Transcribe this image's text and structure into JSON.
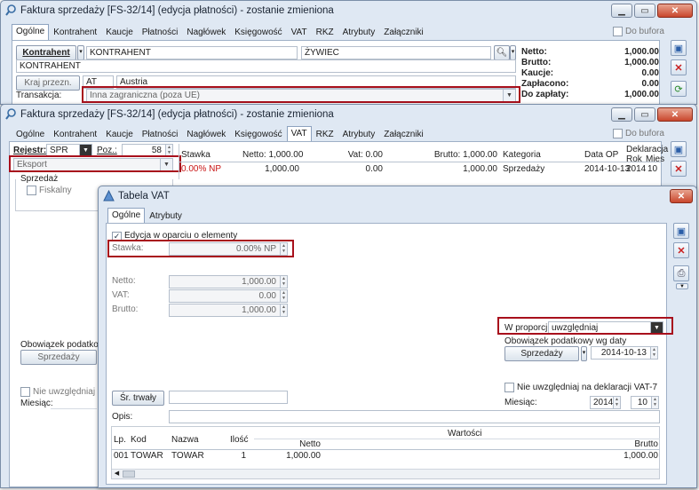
{
  "w1": {
    "title": "Faktura sprzedaży [FS-32/14] (edycja płatności) - zostanie zmieniona",
    "tabs": [
      "Ogólne",
      "Kontrahent",
      "Kaucje",
      "Płatności",
      "Nagłówek",
      "Księgowość",
      "VAT",
      "RKZ",
      "Atrybuty",
      "Załączniki"
    ],
    "do_bufora": "Do bufora",
    "kontrahent_btn": "Kontrahent",
    "kontrahent_code": "KONTRAHENT",
    "city": "ŻYWIEC",
    "kontrahent_name": "KONTRAHENT",
    "kraj_btn": "Kraj przezn.",
    "kraj_code": "AT",
    "kraj_name": "Austria",
    "transakcja_label": "Transakcja:",
    "transakcja_value": "Inna zagraniczna (poza UE)",
    "summary": [
      {
        "label": "Netto:",
        "value": "1,000.00"
      },
      {
        "label": "Brutto:",
        "value": "1,000.00"
      },
      {
        "label": "Kaucje:",
        "value": "0.00"
      },
      {
        "label": "Zapłacono:",
        "value": "0.00"
      },
      {
        "label": "Do zapłaty:",
        "value": "1,000.00"
      }
    ]
  },
  "w2": {
    "title": "Faktura sprzedaży [FS-32/14] (edycja płatności) - zostanie zmieniona",
    "tabs": [
      "Ogólne",
      "Kontrahent",
      "Kaucje",
      "Płatności",
      "Nagłówek",
      "Księgowość",
      "VAT",
      "RKZ",
      "Atrybuty",
      "Załączniki"
    ],
    "do_bufora": "Do bufora",
    "rejestr_label": "Rejestr:",
    "rejestr_value": "SPR",
    "poz_label": "Poz.:",
    "poz_value": "58",
    "eksport": "Eksport",
    "sprzedaz_group": "Sprzedaż",
    "fiskalny": "Fiskalny",
    "obowiazek_label": "Obowiązek podatkowy",
    "sprzedazy_btn": "Sprzedaży",
    "nie_uwzgl": "Nie uwzględniaj na d",
    "miesiac_label": "Miesiąc:",
    "table_headers": [
      "Stawka",
      "Netto: 1,000.00",
      "Vat: 0.00",
      "Brutto: 1,000.00",
      "Kategoria",
      "Data OP",
      "Deklaracja",
      "Rok",
      "Mies"
    ],
    "table_row": {
      "stawka": "0.00% NP",
      "netto": "1,000.00",
      "vat": "0.00",
      "brutto": "1,000.00",
      "kategoria": "Sprzedaży",
      "data": "2014-10-13",
      "rok": "2014",
      "mies": "10"
    }
  },
  "w3": {
    "title": "Tabela VAT",
    "tabs": [
      "Ogólne",
      "Atrybuty"
    ],
    "edycja": "Edycja w oparciu o elementy",
    "stawka_label": "Stawka:",
    "stawka_value": "0.00% NP",
    "netto_label": "Netto:",
    "netto_value": "1,000.00",
    "vat_label": "VAT:",
    "vat_value": "0.00",
    "brutto_label": "Brutto:",
    "brutto_value": "1,000.00",
    "proporcji_label": "W proporcji:",
    "proporcji_value": "uwzględniaj",
    "obowiazek_label": "Obowiązek podatkowy wg daty",
    "sprzedazy_btn": "Sprzedaży",
    "obow_date": "2014-10-13",
    "nie_uwzgl": "Nie uwzględniaj na deklaracji VAT-7",
    "miesiac_label": "Miesiąc:",
    "miesiac_year": "2014",
    "miesiac_month": "10",
    "srtrwaly_btn": "Śr. trwały",
    "opis_label": "Opis:",
    "wartosci_label": "Wartości",
    "items_headers": [
      "Lp.",
      "Kod",
      "Nazwa",
      "Ilość",
      "Netto",
      "Brutto"
    ],
    "items": [
      {
        "lp": "001",
        "kod": "TOWAR",
        "nazwa": "TOWAR",
        "ilosc": "1",
        "netto": "1,000.00",
        "brutto": "1,000.00"
      }
    ]
  }
}
